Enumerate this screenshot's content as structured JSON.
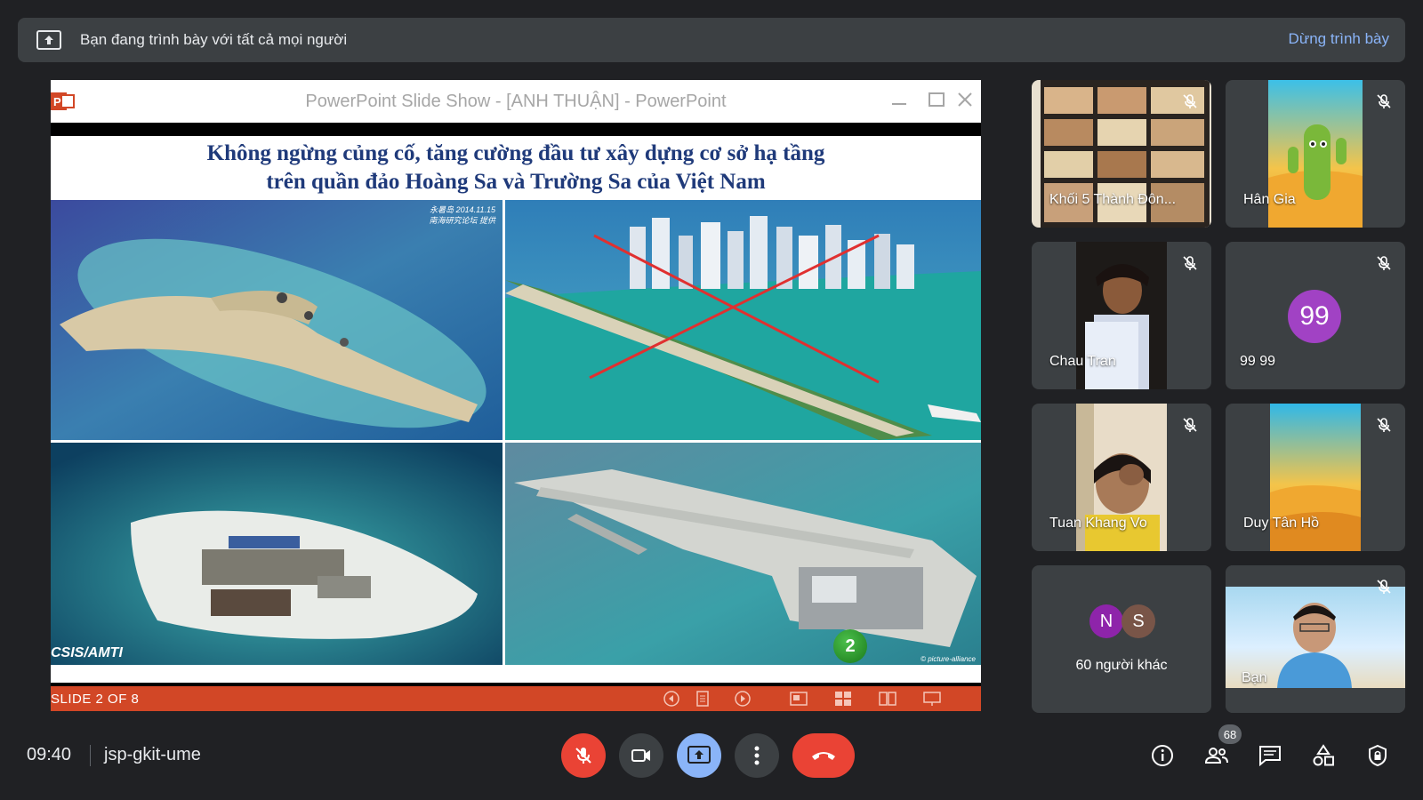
{
  "banner": {
    "title": "Bạn đang trình bày với tất cả mọi người",
    "stop_label": "Dừng trình bày"
  },
  "powerpoint": {
    "window_title": "PowerPoint Slide Show - [ANH THUẬN] - PowerPoint",
    "slide_heading_line1": "Không ngừng củng cố, tăng cường đầu tư xây dựng cơ sở hạ tầng",
    "slide_heading_line2": "trên quần đảo Hoàng Sa và Trường Sa của Việt Nam",
    "photo_caption_topleft": "永暑岛 2014.11.15",
    "photo_caption_topleft2": "南海研究论坛 提供",
    "photo_caption_bottomleft": "CSIS/AMTI",
    "photo_caption_bottomright": "© picture-alliance",
    "badge_number": "2",
    "status_text": "SLIDE 2 OF 8"
  },
  "participants": [
    {
      "name": "Khối 5 Thành Đôn..."
    },
    {
      "name": "Hân Gia"
    },
    {
      "name": "Chau Tran"
    },
    {
      "name": "99 99",
      "avatar_text": "99"
    },
    {
      "name": "Tuan Khang Vo"
    },
    {
      "name": "Duy Tân Hồ"
    },
    {
      "name": "60 người khác",
      "avatar1": "N",
      "avatar2": "S"
    },
    {
      "name": "Bạn"
    }
  ],
  "bottom_bar": {
    "time": "09:40",
    "meeting_code": "jsp-gkit-ume",
    "participant_count": "68"
  },
  "colors": {
    "background": "#202124",
    "tile": "#3c4043",
    "accent_blue": "#8ab4f8",
    "hangup_red": "#ea4335",
    "ppt_orange": "#d24726"
  }
}
